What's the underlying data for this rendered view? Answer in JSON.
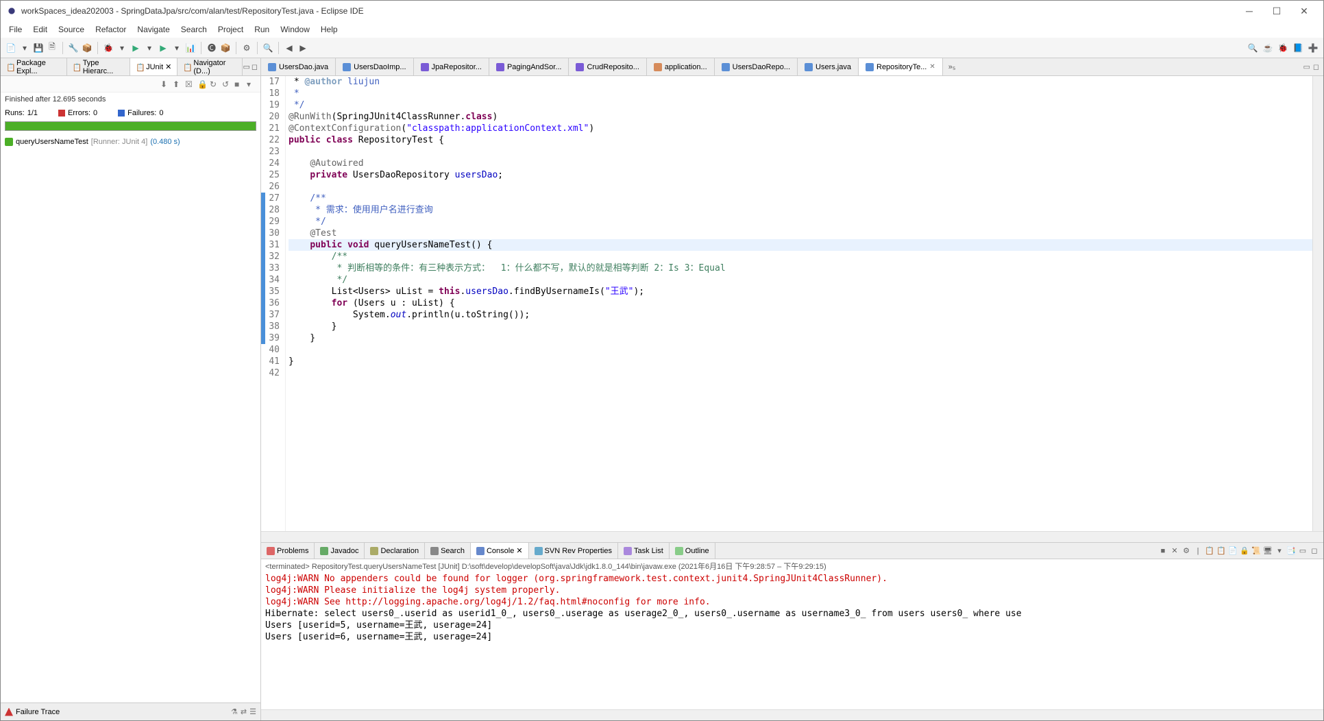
{
  "window": {
    "title": "workSpaces_idea202003 - SpringDataJpa/src/com/alan/test/RepositoryTest.java - Eclipse IDE"
  },
  "menu": [
    "File",
    "Edit",
    "Source",
    "Refactor",
    "Navigate",
    "Search",
    "Project",
    "Run",
    "Window",
    "Help"
  ],
  "leftPanel": {
    "tabs": [
      {
        "label": "Package Expl..."
      },
      {
        "label": "Type Hierarc..."
      },
      {
        "label": "JUnit",
        "active": true
      },
      {
        "label": "Navigator (D...)"
      }
    ],
    "finished": "Finished after 12.695 seconds",
    "stats": {
      "runs_label": "Runs:",
      "runs_value": "1/1",
      "errors_label": "Errors:",
      "errors_value": "0",
      "failures_label": "Failures:",
      "failures_value": "0"
    },
    "test": {
      "name": "queryUsersNameTest",
      "runner": "[Runner: JUnit 4]",
      "time": "(0.480 s)"
    },
    "failureTrace": "Failure Trace"
  },
  "editorTabs": [
    {
      "label": "UsersDao.java",
      "icon": "cls"
    },
    {
      "label": "UsersDaoImp...",
      "icon": "cls"
    },
    {
      "label": "JpaRepositor...",
      "icon": "iface"
    },
    {
      "label": "PagingAndSor...",
      "icon": "iface"
    },
    {
      "label": "CrudReposito...",
      "icon": "iface"
    },
    {
      "label": "application...",
      "icon": "xml"
    },
    {
      "label": "UsersDaoRepo...",
      "icon": "cls"
    },
    {
      "label": "Users.java",
      "icon": "cls"
    },
    {
      "label": "RepositoryTe...",
      "icon": "cls",
      "active": true,
      "closable": true
    }
  ],
  "moreTabs": "»₅",
  "code": {
    "startLine": 17,
    "lines": [
      {
        "n": 17,
        "html": " * <span class='tag'>@author</span> <span class='cmt'>liujun</span>"
      },
      {
        "n": 18,
        "html": "<span class='cmt'> *</span>"
      },
      {
        "n": 19,
        "html": "<span class='cmt'> */</span>"
      },
      {
        "n": 20,
        "html": "<span class='ann'>@RunWith</span>(SpringJUnit4ClassRunner.<span class='kw'>class</span>)"
      },
      {
        "n": 21,
        "html": "<span class='ann'>@ContextConfiguration</span>(<span class='str'>\"classpath:applicationContext.xml\"</span>)"
      },
      {
        "n": 22,
        "html": "<span class='kw'>public</span> <span class='kw'>class</span> RepositoryTest {"
      },
      {
        "n": 23,
        "html": ""
      },
      {
        "n": 24,
        "html": "    <span class='ann'>@Autowired</span>",
        "fold": true
      },
      {
        "n": 25,
        "html": "    <span class='kw'>private</span> UsersDaoRepository <span class='fld'>usersDao</span>;"
      },
      {
        "n": 26,
        "html": ""
      },
      {
        "n": 27,
        "html": "    <span class='cmt'>/**</span>",
        "blue": true,
        "fold": true
      },
      {
        "n": 28,
        "html": "<span class='cmt'>     * 需求：使用用户名进行查询</span>",
        "blue": true
      },
      {
        "n": 29,
        "html": "<span class='cmt'>     */</span>",
        "blue": true
      },
      {
        "n": 30,
        "html": "    <span class='ann'>@Test</span>",
        "blue": true,
        "fold": true
      },
      {
        "n": 31,
        "html": "    <span class='kw'>public</span> <span class='kw'>void</span> queryUsersNameTest() {",
        "blue": true,
        "hl": true
      },
      {
        "n": 32,
        "html": "        <span class='cmtg'>/**</span>",
        "blue": true
      },
      {
        "n": 33,
        "html": "<span class='cmtg'>         * 判断相等的条件：有三种表示方式：  1：什么都不写，默认的就是相等判断 2：Is 3：Equal</span>",
        "blue": true
      },
      {
        "n": 34,
        "html": "<span class='cmtg'>         */</span>",
        "blue": true
      },
      {
        "n": 35,
        "html": "        List&lt;Users&gt; uList = <span class='kw'>this</span>.<span class='fld'>usersDao</span>.findByUsernameIs(<span class='str'>\"王武\"</span>);",
        "blue": true
      },
      {
        "n": 36,
        "html": "        <span class='kw'>for</span> (Users u : uList) {",
        "blue": true
      },
      {
        "n": 37,
        "html": "            System.<span class='sfld'>out</span>.println(u.toString());",
        "blue": true
      },
      {
        "n": 38,
        "html": "        }",
        "blue": true
      },
      {
        "n": 39,
        "html": "    }",
        "blue": true
      },
      {
        "n": 40,
        "html": ""
      },
      {
        "n": 41,
        "html": "}",
        "fold": true
      },
      {
        "n": 42,
        "html": ""
      }
    ]
  },
  "bottomTabs": [
    {
      "label": "Problems",
      "ico": "#d66"
    },
    {
      "label": "Javadoc",
      "ico": "#6a6"
    },
    {
      "label": "Declaration",
      "ico": "#aa6"
    },
    {
      "label": "Search",
      "ico": "#888"
    },
    {
      "label": "Console",
      "ico": "#68c",
      "active": true,
      "closable": true
    },
    {
      "label": "SVN Rev Properties",
      "ico": "#6ac"
    },
    {
      "label": "Task List",
      "ico": "#a8d"
    },
    {
      "label": "Outline",
      "ico": "#8c8"
    }
  ],
  "terminated": "<terminated> RepositoryTest.queryUsersNameTest [JUnit] D:\\soft\\develop\\developSoft\\java\\Jdk\\jdk1.8.0_144\\bin\\javaw.exe  (2021年6月16日 下午9:28:57 – 下午9:29:15)",
  "console": [
    {
      "text": "log4j:WARN No appenders could be found for logger (org.springframework.test.context.junit4.SpringJUnit4ClassRunner).",
      "red": true
    },
    {
      "text": "log4j:WARN Please initialize the log4j system properly.",
      "red": true
    },
    {
      "text": "log4j:WARN See http://logging.apache.org/log4j/1.2/faq.html#noconfig for more info.",
      "red": true
    },
    {
      "text": "Hibernate: select users0_.userid as userid1_0_, users0_.userage as userage2_0_, users0_.username as username3_0_ from users users0_ where use"
    },
    {
      "text": "Users [userid=5, username=王武, userage=24]"
    },
    {
      "text": "Users [userid=6, username=王武, userage=24]"
    }
  ]
}
